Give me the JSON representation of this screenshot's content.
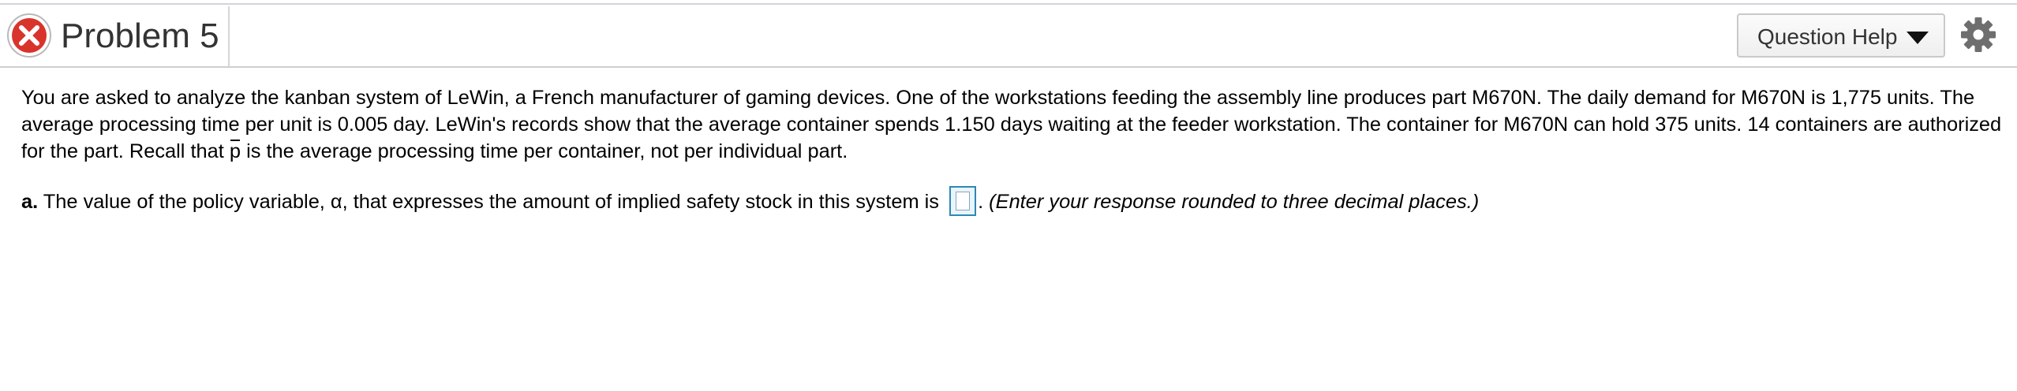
{
  "header": {
    "title": "Problem 5",
    "status": "incorrect",
    "status_icon": "close-icon",
    "status_color": "#d9342b",
    "help_button_label": "Question Help",
    "help_caret_icon": "caret-down-icon",
    "settings_icon": "gear-icon"
  },
  "problem": {
    "intro": "You are asked to analyze the kanban system of LeWin, a French manufacturer of gaming devices. One of the workstations feeding the assembly line produces part M670N. The daily demand for M670N is 1,775 units. The average processing time per unit is 0.005 day. LeWin's records show that the average container spends 1.150 days waiting at the feeder workstation. The container for M670N can hold 375 units. 14 containers are authorized for the part. Recall that ",
    "p_symbol": "p",
    "intro_end": " is the average processing time per container, not per individual part."
  },
  "part_a": {
    "letter": "a.",
    "question": " The value of the policy variable, α, that expresses the amount of implied safety stock in this system is ",
    "answer_value": "",
    "after_box": ". ",
    "instruction": "(Enter your response rounded to three decimal places.)"
  },
  "colors": {
    "accent": "#2e88b5",
    "incorrect": "#d9342b",
    "border": "#cfcfcf"
  }
}
